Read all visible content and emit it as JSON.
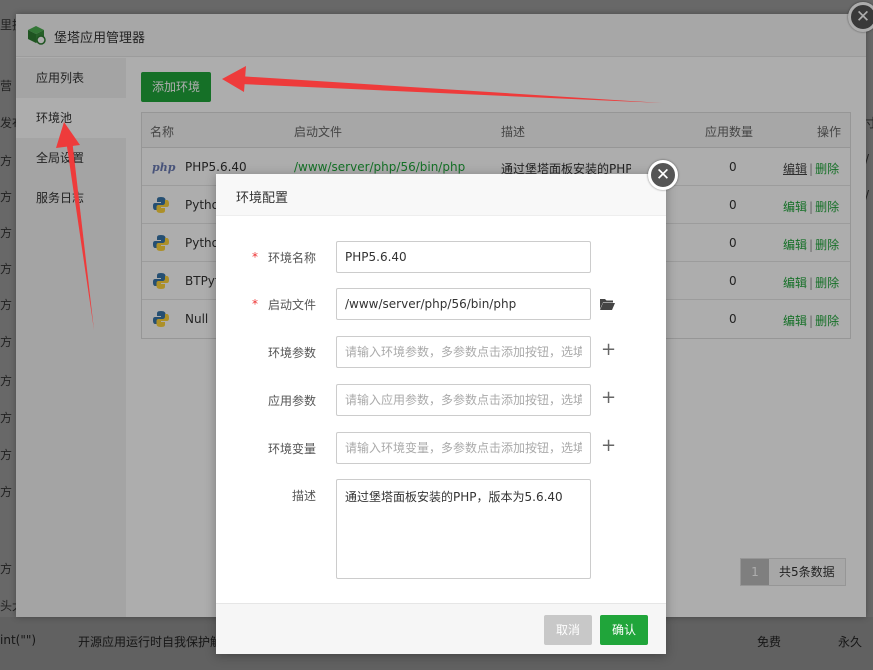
{
  "background": {
    "left_fragments": [
      "里换",
      "营",
      "发布",
      "方",
      "方",
      "方",
      "方",
      "方",
      "方",
      "方",
      "方",
      "方",
      "方",
      "方",
      "头大"
    ],
    "right_fragments": [
      "寸",
      "/",
      "/"
    ],
    "bottom": {
      "code": "int(\"\")",
      "desc": "开源应用运行时自我保护解",
      "price": "免费",
      "term": "永久"
    }
  },
  "window": {
    "title": "堡塔应用管理器",
    "sidebar": [
      {
        "label": "应用列表"
      },
      {
        "label": "环境池"
      },
      {
        "label": "全局设置"
      },
      {
        "label": "服务日志"
      }
    ],
    "add_button": "添加环境",
    "table": {
      "headers": [
        "名称",
        "启动文件",
        "描述",
        "应用数量",
        "操作"
      ],
      "rows": [
        {
          "icon": "php-icon",
          "icon_text": "php",
          "name": "PHP5.6.40",
          "file": "/www/server/php/56/bin/php",
          "desc": "通过堡塔面板安装的PHP，版",
          "count": "0",
          "edit": "编辑",
          "del": "删除"
        },
        {
          "icon": "python-icon",
          "name": "Pytho",
          "file": "",
          "desc": "",
          "count": "0",
          "edit": "编辑",
          "del": "删除"
        },
        {
          "icon": "python-icon",
          "name": "Pytho",
          "file": "",
          "desc": "",
          "count": "0",
          "edit": "编辑",
          "del": "删除"
        },
        {
          "icon": "python-icon",
          "name": "BTPyt",
          "file": "",
          "desc": "",
          "count": "0",
          "edit": "编辑",
          "del": "删除"
        },
        {
          "icon": "python-icon",
          "name": "Null",
          "file": "",
          "desc": "",
          "count": "0",
          "edit": "编辑",
          "del": "删除"
        }
      ],
      "separator": "|"
    },
    "pager": {
      "current": "1",
      "total": "共5条数据"
    }
  },
  "modal": {
    "title": "环境配置",
    "required_mark": "*",
    "fields": {
      "name": {
        "label": "环境名称",
        "value": "PHP5.6.40"
      },
      "start_file": {
        "label": "启动文件",
        "value": "/www/server/php/56/bin/php"
      },
      "env_params": {
        "label": "环境参数",
        "placeholder": "请输入环境参数，多参数点击添加按钮，选填"
      },
      "app_params": {
        "label": "应用参数",
        "placeholder": "请输入应用参数，多参数点击添加按钮，选填"
      },
      "env_vars": {
        "label": "环境变量",
        "placeholder": "请输入环境变量，多参数点击添加按钮，选填"
      },
      "description": {
        "label": "描述",
        "value": "通过堡塔面板安装的PHP，版本为5.6.40"
      }
    },
    "plus": "+",
    "cancel": "取消",
    "confirm": "确认"
  },
  "colors": {
    "accent": "#20a53a",
    "annotation": "#ee3b3b"
  },
  "close_glyph": "✕"
}
